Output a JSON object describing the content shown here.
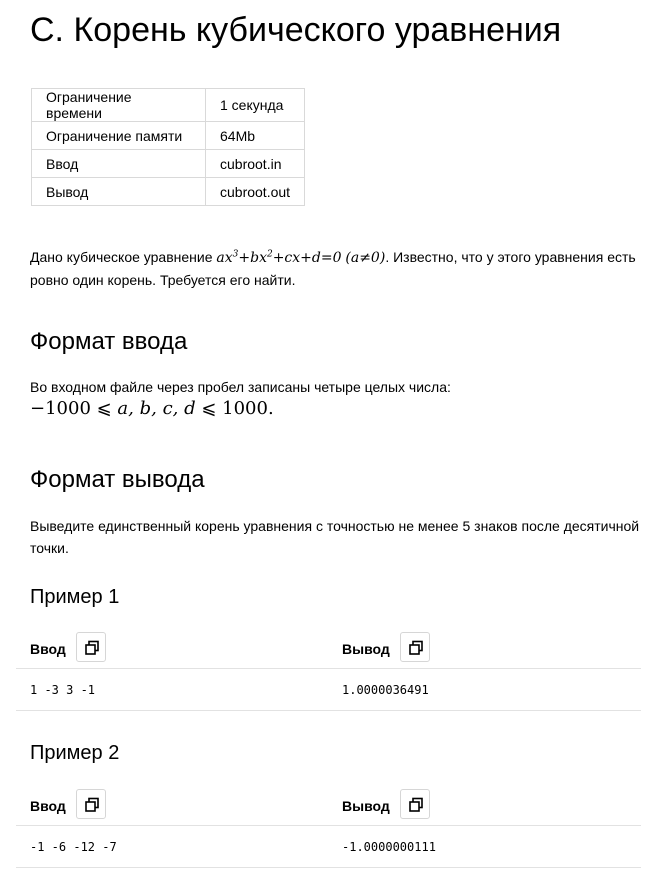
{
  "problem": {
    "title": "C. Корень кубического уравнения",
    "limits": [
      {
        "key": "Ограничение времени",
        "value": "1 секунда"
      },
      {
        "key": "Ограничение памяти",
        "value": "64Mb"
      },
      {
        "key": "Ввод",
        "value": "cubroot.in"
      },
      {
        "key": "Вывод",
        "value": "cubroot.out"
      }
    ],
    "statement": {
      "prefix": "Дано кубическое уравнение",
      "formula_a": "ax",
      "formula_sup3": "3",
      "formula_b": "+bx",
      "formula_sup2": "2",
      "formula_c": "+cx+d=0",
      "condition": "(a≠0)",
      "suffix": ". Известно, что у этого уравнения есть ровно один корень. Требуется его найти."
    }
  },
  "input_format": {
    "heading": "Формат ввода",
    "text": "Во входном файле через пробел записаны четыре целых числа:",
    "math_left": "−1000 ⩽ ",
    "math_vars": "a, b, c, d",
    "math_right": " ⩽ 1000."
  },
  "output_format": {
    "heading": "Формат вывода",
    "text": "Выведите единственный корень уравнения с точностью не менее 5 знаков после десятичной точки."
  },
  "examples": [
    {
      "heading": "Пример 1",
      "input_label": "Ввод",
      "output_label": "Вывод",
      "input": "1 -3 3 -1",
      "output": "1.0000036491"
    },
    {
      "heading": "Пример 2",
      "input_label": "Ввод",
      "output_label": "Вывод",
      "input": "-1 -6 -12 -7",
      "output": "-1.0000000111"
    }
  ]
}
